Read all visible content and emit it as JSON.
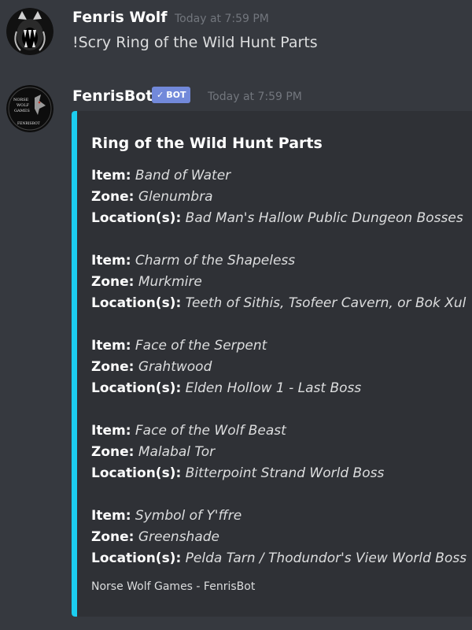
{
  "messages": [
    {
      "author": "Fenris Wolf",
      "timestamp": "Today at 7:59 PM",
      "content": "!Scry Ring of the Wild Hunt Parts",
      "avatar_icon": "wolf-head-icon"
    },
    {
      "author": "FenrisBot",
      "bot_tag": "BOT",
      "bot_check": "✓",
      "timestamp": "Today at 7:59 PM",
      "avatar_icon": "norse-wolf-games-logo",
      "avatar_logo_text": "NORSE WOLF GAMES FENRISBOT",
      "embed": {
        "accent_color": "#1ccdef",
        "title": "Ring of the Wild Hunt Parts",
        "labels": {
          "item": "Item:",
          "zone": "Zone:",
          "location": "Location(s):"
        },
        "entries": [
          {
            "item": "Band of Water",
            "zone": "Glenumbra",
            "location": "Bad Man's Hallow Public Dungeon Bosses"
          },
          {
            "item": "Charm of the Shapeless",
            "zone": "Murkmire",
            "location": "Teeth of Sithis, Tsofeer Cavern, or Bok Xul"
          },
          {
            "item": "Face of the Serpent",
            "zone": "Grahtwood",
            "location": "Elden Hollow 1 - Last Boss"
          },
          {
            "item": "Face of the Wolf Beast",
            "zone": "Malabal Tor",
            "location": "Bitterpoint Strand World Boss"
          },
          {
            "item": "Symbol of Y'ffre",
            "zone": "Greenshade",
            "location": "Pelda Tarn / Thodundor's View World Boss"
          }
        ],
        "footer": "Norse Wolf Games - FenrisBot"
      }
    }
  ],
  "colors": {
    "background": "#36393f",
    "embed_background": "#2f3136",
    "bot_tag": "#7289da",
    "timestamp": "#72767d"
  }
}
